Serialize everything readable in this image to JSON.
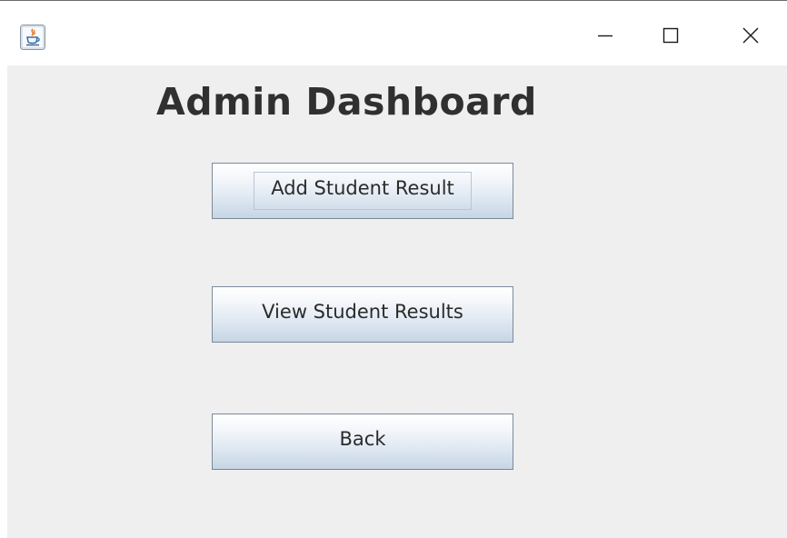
{
  "titlebar": {
    "icon": "java-cup-icon",
    "controls": {
      "minimize_icon": "minimize-icon",
      "maximize_icon": "maximize-icon",
      "close_icon": "close-icon"
    }
  },
  "content": {
    "heading": "Admin Dashboard",
    "buttons": {
      "add_student_result": "Add Student Result",
      "view_student_results": "View Student Results",
      "back": "Back"
    },
    "focused_button": "add_student_result"
  },
  "colors": {
    "panel_background": "#efefef",
    "heading_text": "#303030",
    "button_border": "#7a8a99",
    "button_gradient_bottom": "#c6d5e4"
  }
}
